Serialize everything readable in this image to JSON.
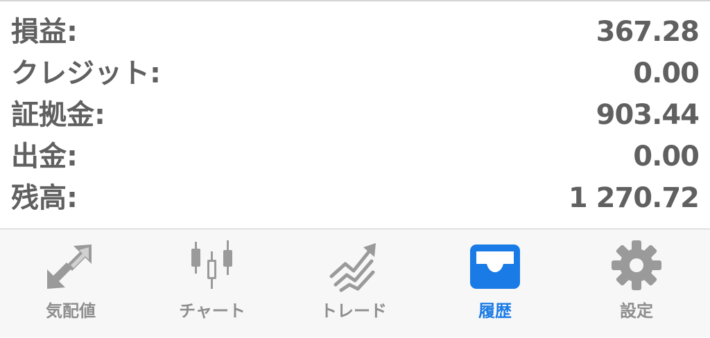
{
  "summary": {
    "rows": [
      {
        "label": "損益:",
        "value": "367.28"
      },
      {
        "label": "クレジット:",
        "value": "0.00"
      },
      {
        "label": "証拠金:",
        "value": "903.44"
      },
      {
        "label": "出金:",
        "value": "0.00"
      },
      {
        "label": "残高:",
        "value": "1 270.72"
      }
    ]
  },
  "tabbar": {
    "tabs": [
      {
        "label": "気配値",
        "icon": "quotes-arrows-icon",
        "active": false
      },
      {
        "label": "チャート",
        "icon": "candlestick-chart-icon",
        "active": false
      },
      {
        "label": "トレード",
        "icon": "trade-trend-icon",
        "active": false
      },
      {
        "label": "履歴",
        "icon": "history-tray-icon",
        "active": true
      },
      {
        "label": "設定",
        "icon": "gear-icon",
        "active": false
      }
    ]
  },
  "colors": {
    "text": "#606060",
    "inactive": "#8e8e8e",
    "icon_inactive": "#9a9a9a",
    "accent": "#1a7be6",
    "tabbar_bg": "#f7f7f7"
  }
}
